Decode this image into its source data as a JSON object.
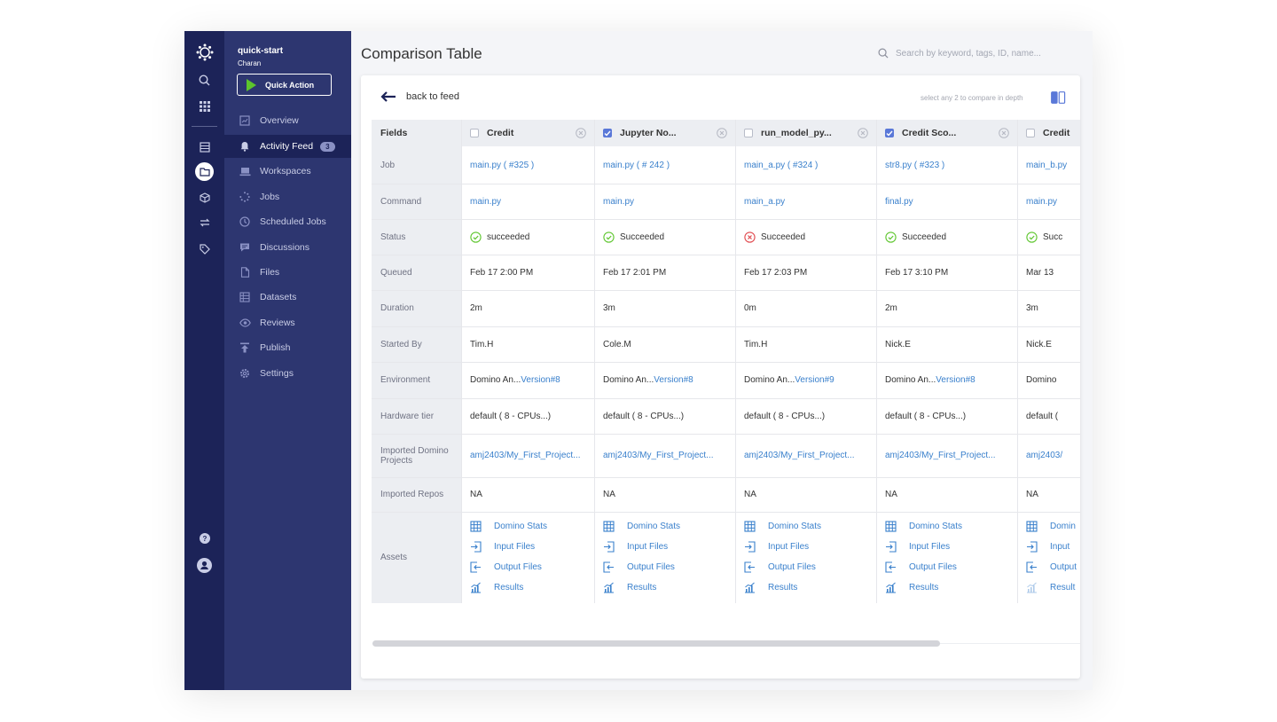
{
  "sidebar": {
    "project": "quick-start",
    "user": "Charan",
    "quick_action": "Quick Action",
    "items": [
      {
        "label": "Overview",
        "icon": "overview-icon"
      },
      {
        "label": "Activity Feed",
        "icon": "bell-icon",
        "badge": "3",
        "active": true
      },
      {
        "label": "Workspaces",
        "icon": "laptop-icon"
      },
      {
        "label": "Jobs",
        "icon": "spinner-icon"
      },
      {
        "label": "Scheduled Jobs",
        "icon": "clock-icon"
      },
      {
        "label": "Discussions",
        "icon": "chat-icon"
      },
      {
        "label": "Files",
        "icon": "file-icon"
      },
      {
        "label": "Datasets",
        "icon": "table-icon"
      },
      {
        "label": "Reviews",
        "icon": "eye-icon"
      },
      {
        "label": "Publish",
        "icon": "upload-icon"
      },
      {
        "label": "Settings",
        "icon": "gear-icon"
      }
    ]
  },
  "header": {
    "title": "Comparison Table",
    "search_placeholder": "Search by keyword, tags, ID, name..."
  },
  "card": {
    "back_label": "back to feed",
    "hint": "select any 2 to compare in depth"
  },
  "table": {
    "fields_header": "Fields",
    "row_labels": [
      "Job",
      "Command",
      "Status",
      "Queued",
      "Duration",
      "Started By",
      "Environment",
      "Hardware tier",
      "Imported Domino Projects",
      "Imported Repos",
      "Assets"
    ],
    "columns": [
      {
        "name": "Credit",
        "checked": false,
        "job": "main.py ( #325 )",
        "command": "main.py",
        "status": "succeeded",
        "status_ok": true,
        "queued": "Feb 17 2:00 PM",
        "duration": "2m",
        "started_by": "Tim.H",
        "env_name": "Domino An...",
        "env_version": "Version#8",
        "hardware": "default ( 8 - CPUs...)",
        "imported_projects": "amj2403/My_First_Project...",
        "imported_repos": "NA"
      },
      {
        "name": "Jupyter No...",
        "checked": true,
        "job": "main.py ( # 242 )",
        "command": "main.py",
        "status": "Succeeded",
        "status_ok": true,
        "queued": "Feb 17 2:01 PM",
        "duration": "3m",
        "started_by": "Cole.M",
        "env_name": "Domino An...",
        "env_version": "Version#8",
        "hardware": "default ( 8 - CPUs...)",
        "imported_projects": "amj2403/My_First_Project...",
        "imported_repos": "NA"
      },
      {
        "name": "run_model_py...",
        "checked": false,
        "job": "main_a.py ( #324 )",
        "command": "main_a.py",
        "status": "Succeeded",
        "status_ok": false,
        "queued": "Feb 17 2:03 PM",
        "duration": "0m",
        "started_by": "Tim.H",
        "env_name": "Domino An...",
        "env_version": "Version#9",
        "hardware": "default ( 8 - CPUs...)",
        "imported_projects": "amj2403/My_First_Project...",
        "imported_repos": "NA"
      },
      {
        "name": "Credit Sco...",
        "checked": true,
        "job": "str8.py ( #323 )",
        "command": "final.py",
        "status": "Succeeded",
        "status_ok": true,
        "queued": "Feb 17 3:10 PM",
        "duration": "2m",
        "started_by": "Nick.E",
        "env_name": "Domino An...",
        "env_version": "Version#8",
        "hardware": "default ( 8 - CPUs...)",
        "imported_projects": "amj2403/My_First_Project...",
        "imported_repos": "NA"
      },
      {
        "name": "Credit",
        "checked": false,
        "job": "main_b.py",
        "command": "main.py",
        "status": "Succ",
        "status_ok": true,
        "queued": "Mar 13",
        "duration": "3m",
        "started_by": "Nick.E",
        "env_name": "Domino",
        "env_version": "",
        "hardware": "default (",
        "imported_projects": "amj2403/",
        "imported_repos": "NA"
      }
    ],
    "assets_full": [
      "Domino Stats",
      "Input Files",
      "Output Files",
      "Results"
    ],
    "assets_cut": [
      "Domin",
      "Input",
      "Output",
      "Result"
    ]
  },
  "colors": {
    "rail": "#1c2358",
    "sidebar": "#2d3670",
    "link": "#3a80cc",
    "accent": "#5a78d8",
    "success": "#5cc52c",
    "error": "#e0474c"
  }
}
